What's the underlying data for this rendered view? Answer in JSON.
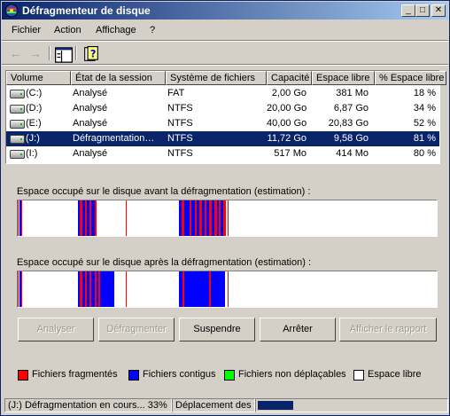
{
  "window": {
    "title": "Défragmenteur de disque",
    "controls": {
      "minimize": "_",
      "maximize": "□",
      "close": "✕"
    }
  },
  "menu": [
    {
      "label": "Fichier"
    },
    {
      "label": "Action"
    },
    {
      "label": "Affichage"
    },
    {
      "label": "?"
    }
  ],
  "toolbar": {
    "icons": [
      "back-arrow-icon",
      "forward-arrow-icon",
      "show-hide-console-tree-icon",
      "help-icon"
    ]
  },
  "table": {
    "columns": [
      "Volume",
      "État de la session",
      "Système de fichiers",
      "Capacité",
      "Espace libre",
      "% Espace libre"
    ],
    "rows": [
      {
        "volume": "(C:)",
        "state": "Analysé",
        "fs": "FAT",
        "capacity": "2,00 Go",
        "free": "381 Mo",
        "pct": "18 %",
        "selected": false
      },
      {
        "volume": "(D:)",
        "state": "Analysé",
        "fs": "NTFS",
        "capacity": "20,00 Go",
        "free": "6,87 Go",
        "pct": "34 %",
        "selected": false
      },
      {
        "volume": "(E:)",
        "state": "Analysé",
        "fs": "NTFS",
        "capacity": "40,00 Go",
        "free": "20,83 Go",
        "pct": "52 %",
        "selected": false
      },
      {
        "volume": "(J:)",
        "state": "Défragmentation…",
        "fs": "NTFS",
        "capacity": "11,72 Go",
        "free": "9,58 Go",
        "pct": "81 %",
        "selected": true
      },
      {
        "volume": "(I:)",
        "state": "Analysé",
        "fs": "NTFS",
        "capacity": "517 Mo",
        "free": "414 Mo",
        "pct": "80 %",
        "selected": false
      }
    ]
  },
  "before_label": "Espace occupé sur le disque avant la défragmentation (estimation) :",
  "after_label": "Espace occupé sur le disque après la défragmentation (estimation) :",
  "buttons": {
    "analyze": "Analyser",
    "defragment": "Défragmenter",
    "pause": "Suspendre",
    "stop": "Arrêter",
    "report": "Afficher le rapport"
  },
  "legend": [
    {
      "label": "Fichiers fragmentés",
      "color": "#ff0000"
    },
    {
      "label": "Fichiers contigus",
      "color": "#0000ff"
    },
    {
      "label": "Fichiers non déplaçables",
      "color": "#00ff00"
    },
    {
      "label": "Espace libre",
      "color": "#ffffff"
    }
  ],
  "status": {
    "progress_text": "(J:) Défragmentation en cours... 33%",
    "detail_text": "Déplacement des f"
  },
  "colors": {
    "titlebar": "#0a246a",
    "selection": "#0a246a",
    "fragmented": "#ff0000",
    "contiguous": "#0000ff",
    "unmovable": "#00ff00",
    "free": "#ffffff"
  }
}
